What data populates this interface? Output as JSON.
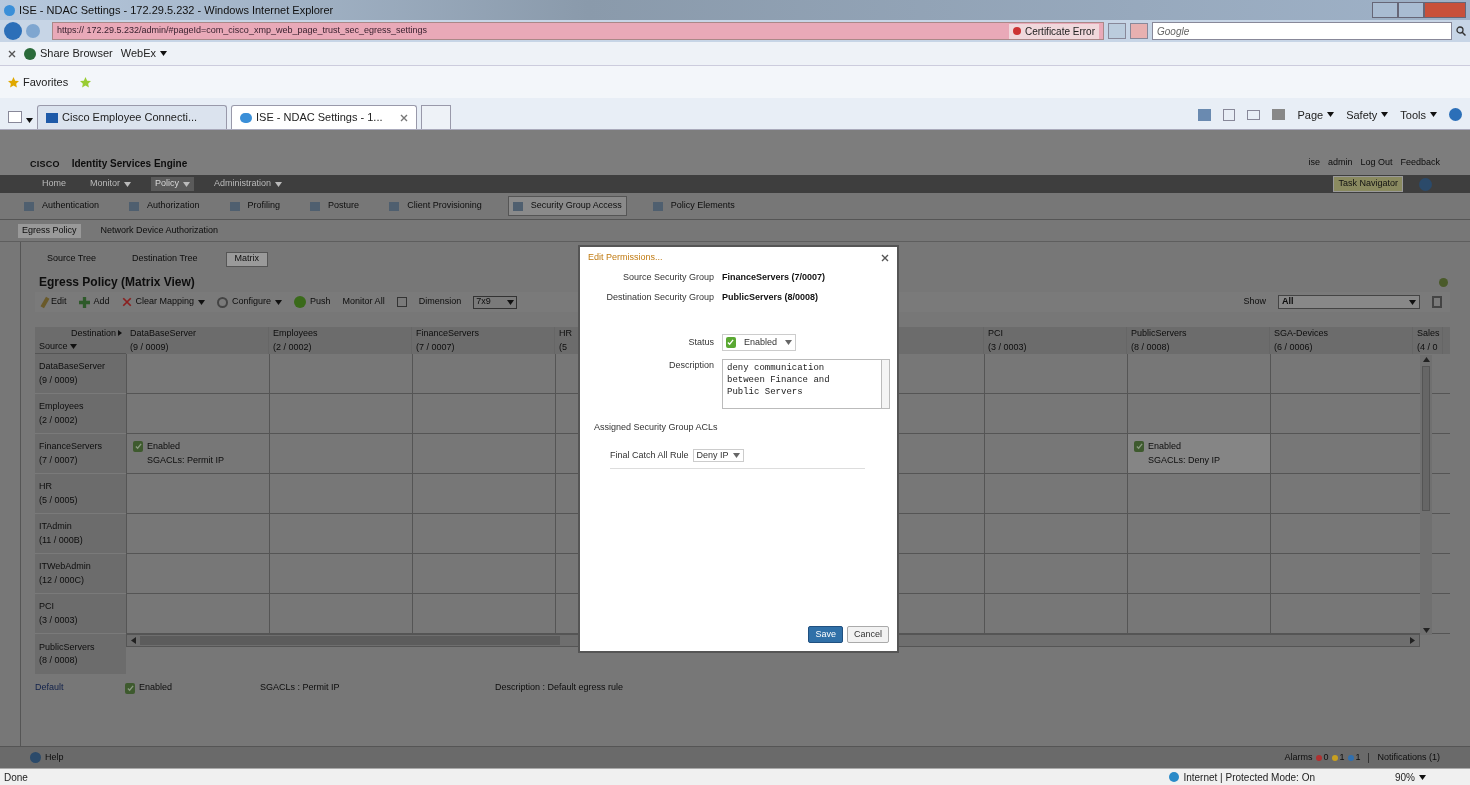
{
  "browser": {
    "title": "ISE - NDAC Settings - 172.29.5.232 - Windows Internet Explorer",
    "address": "https:// 172.29.5.232/admin/#pageId=com_cisco_xmp_web_page_trust_sec_egress_settings",
    "certificate_error": "Certificate Error",
    "search_placeholder": "Google",
    "toolbar": [
      "Share Browser",
      "WebEx"
    ],
    "favorites": "Favorites",
    "tabs": [
      {
        "label": "Cisco Employee Connecti...",
        "selected": false
      },
      {
        "label": "ISE - NDAC Settings - 1...",
        "selected": true
      }
    ],
    "command_bar": [
      "Page",
      "Safety",
      "Tools"
    ]
  },
  "app": {
    "brand": "CISCO",
    "product": "Identity Services Engine",
    "user_links": [
      "ise",
      "admin",
      "Log Out",
      "Feedback"
    ],
    "nav": [
      {
        "label": "Home",
        "dropdown": false,
        "selected": false
      },
      {
        "label": "Monitor",
        "dropdown": true,
        "selected": false
      },
      {
        "label": "Policy",
        "dropdown": true,
        "selected": true
      },
      {
        "label": "Administration",
        "dropdown": true,
        "selected": false
      }
    ],
    "task_navigator": "Task Navigator",
    "policy_tabs": [
      {
        "label": "Authentication",
        "selected": false
      },
      {
        "label": "Authorization",
        "selected": false
      },
      {
        "label": "Profiling",
        "selected": false
      },
      {
        "label": "Posture",
        "selected": false
      },
      {
        "label": "Client Provisioning",
        "selected": false
      },
      {
        "label": "Security Group Access",
        "selected": true
      },
      {
        "label": "Policy Elements",
        "selected": false
      }
    ],
    "sga_tabs": [
      {
        "label": "Egress Policy",
        "selected": true
      },
      {
        "label": "Network Device Authorization",
        "selected": false
      }
    ],
    "view_tabs": [
      {
        "label": "Source Tree",
        "selected": false
      },
      {
        "label": "Destination Tree",
        "selected": false
      },
      {
        "label": "Matrix",
        "selected": true
      }
    ],
    "heading": "Egress Policy (Matrix View)",
    "toolbar": [
      {
        "label": "Edit",
        "kind": "edit",
        "dropdown": false
      },
      {
        "label": "Add",
        "kind": "add",
        "dropdown": false
      },
      {
        "label": "Clear Mapping",
        "kind": "clear",
        "dropdown": true
      },
      {
        "label": "Configure",
        "kind": "configure",
        "dropdown": true
      },
      {
        "label": "Push",
        "kind": "push",
        "dropdown": false
      },
      {
        "label": "Monitor All",
        "kind": "plain",
        "dropdown": false
      }
    ],
    "dimension": {
      "label": "Dimension",
      "checked": false,
      "value": "7x9"
    },
    "show": {
      "label": "Show",
      "value": "All"
    },
    "matrix": {
      "corner_destination": "Destination",
      "corner_source": "Source",
      "columns": [
        {
          "name": "DataBaseServer",
          "id": "(9 / 0009)"
        },
        {
          "name": "Employees",
          "id": "(2 / 0002)"
        },
        {
          "name": "FinanceServers",
          "id": "(7 / 0007)"
        },
        {
          "name": "HR",
          "id": "(5"
        },
        {},
        {},
        {
          "name": "PCI",
          "id": "(3 / 0003)"
        },
        {
          "name": "PublicServers",
          "id": "(8 / 0008)"
        },
        {
          "name": "SGA-Devices",
          "id": "(6 / 0006)"
        },
        {
          "name": "Sales",
          "id": "(4 / 0"
        }
      ],
      "rows": [
        {
          "name": "DataBaseServer",
          "id": "(9 / 0009)",
          "cells": [
            null,
            null,
            null,
            null,
            null,
            null,
            null,
            null,
            null,
            null
          ]
        },
        {
          "name": "Employees",
          "id": "(2 / 0002)",
          "cells": [
            null,
            null,
            null,
            null,
            null,
            null,
            null,
            null,
            null,
            null
          ]
        },
        {
          "name": "FinanceServers",
          "id": "(7 / 0007)",
          "cells": [
            {
              "status": "Enabled",
              "sgacl": "SGACLs: Permit IP",
              "selected": false
            },
            null,
            null,
            null,
            null,
            null,
            null,
            {
              "status": "Enabled",
              "sgacl": "SGACLs: Deny IP",
              "selected": true
            },
            null,
            null
          ]
        },
        {
          "name": "HR",
          "id": "(5 / 0005)",
          "cells": [
            null,
            null,
            null,
            null,
            null,
            null,
            null,
            null,
            null,
            null
          ]
        },
        {
          "name": "ITAdmin",
          "id": "(11 / 000B)",
          "cells": [
            null,
            null,
            null,
            null,
            null,
            null,
            null,
            null,
            null,
            null
          ]
        },
        {
          "name": "ITWebAdmin",
          "id": "(12 / 000C)",
          "cells": [
            null,
            null,
            null,
            null,
            null,
            null,
            null,
            null,
            null,
            null
          ]
        },
        {
          "name": "PCI",
          "id": "(3 / 0003)",
          "cells": [
            null,
            null,
            null,
            null,
            null,
            null,
            null,
            null,
            null,
            null
          ]
        }
      ],
      "last_row": {
        "name": "PublicServers",
        "id": "(8 / 0008)"
      }
    },
    "default_rule": {
      "label": "Default",
      "status": "Enabled",
      "sgacl": "SGACLs : Permit IP",
      "description": "Description : Default egress rule"
    },
    "footer": {
      "help": "Help",
      "alarms_label": "Alarms",
      "alarms": [
        {
          "count": "0",
          "color": "#b03030"
        },
        {
          "count": "1",
          "color": "#c8a020"
        },
        {
          "count": "1",
          "color": "#3070b0"
        }
      ],
      "notifications": "Notifications (1)"
    }
  },
  "dialog": {
    "title": "Edit Permissions...",
    "source_label": "Source Security Group",
    "source_value": "FinanceServers (7/0007)",
    "destination_label": "Destination Security Group",
    "destination_value": "PublicServers (8/0008)",
    "status_label": "Status",
    "status_value": "Enabled",
    "description_label": "Description",
    "description_value": "deny communication between Finance and Public Servers",
    "acl_heading": "Assigned Security Group ACLs",
    "catch_all_label": "Final Catch All Rule",
    "catch_all_value": "Deny IP",
    "buttons": [
      {
        "label": "Save",
        "kind": "primary"
      },
      {
        "label": "Cancel",
        "kind": "secondary"
      }
    ]
  },
  "status_bar": {
    "text": "Done",
    "zone": "Internet | Protected Mode: On",
    "zoom": "90%"
  }
}
